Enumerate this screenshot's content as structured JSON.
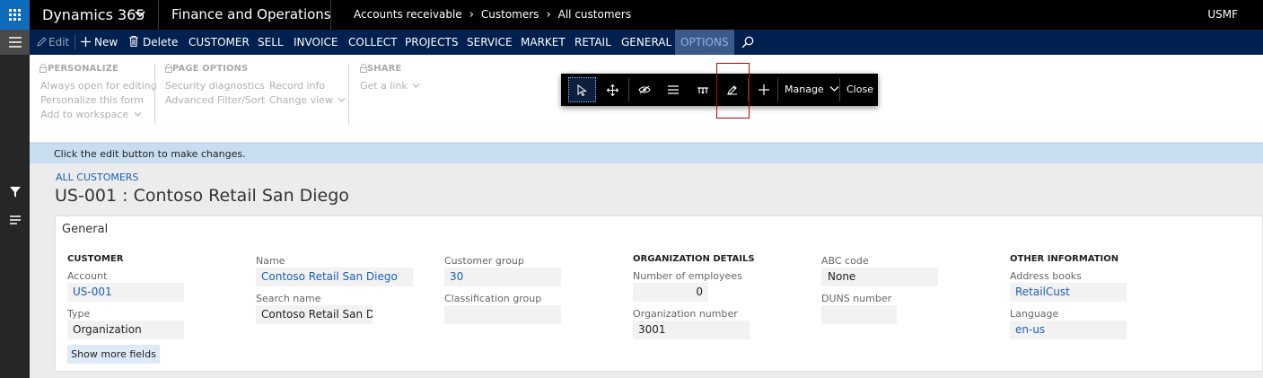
{
  "topbar": {
    "brand": "Dynamics 365",
    "module": "Finance and Operations",
    "breadcrumbs": [
      "Accounts receivable",
      "Customers",
      "All customers"
    ],
    "company": "USMF",
    "icons": [
      "waffle-icon",
      "chevron-down-icon",
      "chevron-right-icon"
    ]
  },
  "action_pane": {
    "edit": "Edit",
    "new": "New",
    "delete": "Delete",
    "tabs": [
      "CUSTOMER",
      "SELL",
      "INVOICE",
      "COLLECT",
      "PROJECTS",
      "SERVICE",
      "MARKET",
      "RETAIL",
      "GENERAL",
      "OPTIONS"
    ],
    "selected_tab": "OPTIONS"
  },
  "ribbon": {
    "groups": [
      {
        "title": "PERSONALIZE",
        "items": [
          "Always open for editing",
          "Personalize this form",
          "Add to workspace"
        ]
      },
      {
        "title": "PAGE OPTIONS",
        "items": [
          "Security diagnostics",
          "Advanced Filter/Sort",
          "Record info",
          "Change view"
        ]
      },
      {
        "title": "SHARE",
        "items": [
          "Get a link"
        ]
      }
    ]
  },
  "edit_toolbar": {
    "manage": "Manage",
    "close": "Close",
    "tools": [
      "select-icon",
      "move-icon",
      "hide-icon",
      "summary-icon",
      "header-icon",
      "edit-properties-icon",
      "add-icon"
    ]
  },
  "banner": "Click the edit button to make changes.",
  "page": {
    "breadcrumb": "ALL CUSTOMERS",
    "title": "US-001 : Contoso Retail San Diego",
    "fasttab": "General"
  },
  "form": {
    "customer_section": "CUSTOMER",
    "account_label": "Account",
    "account_value": "US-001",
    "type_label": "Type",
    "type_value": "Organization",
    "name_label": "Name",
    "name_value": "Contoso Retail San Diego",
    "search_label": "Search name",
    "search_value": "Contoso Retail San D",
    "group_label": "Customer group",
    "group_value": "30",
    "class_label": "Classification group",
    "class_value": "",
    "org_section": "ORGANIZATION DETAILS",
    "employees_label": "Number of employees",
    "employees_value": "0",
    "orgnum_label": "Organization number",
    "orgnum_value": "3001",
    "abc_label": "ABC code",
    "abc_value": "None",
    "duns_label": "DUNS number",
    "duns_value": "",
    "other_section": "OTHER INFORMATION",
    "address_label": "Address books",
    "address_value": "RetailCust",
    "language_label": "Language",
    "language_value": "en-us",
    "more_button": "Show more fields"
  },
  "colors": {
    "topbar": "#000000",
    "action_pane": "#002050",
    "waffle": "#0f6cbd",
    "banner": "#c8ddf0",
    "link": "#1a5fb4",
    "highlight_box": "#c00000"
  }
}
